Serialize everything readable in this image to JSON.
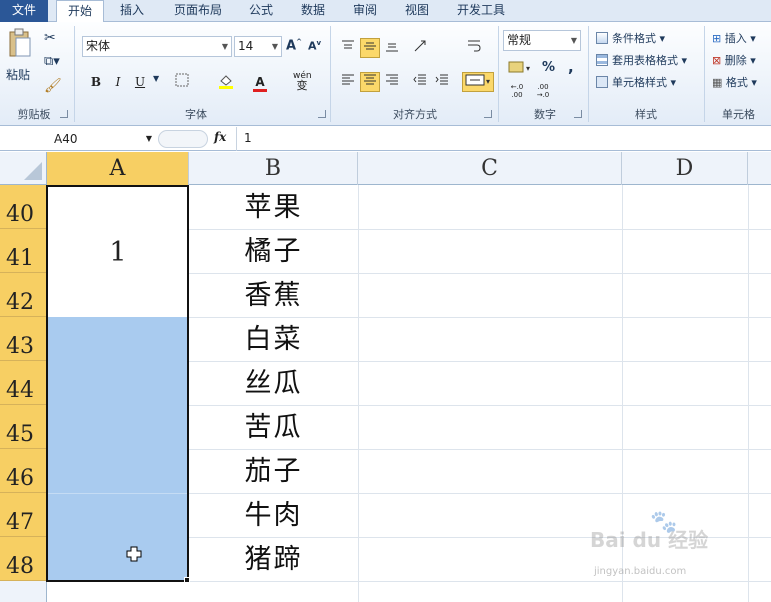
{
  "tabs": [
    "文件",
    "开始",
    "插入",
    "页面布局",
    "公式",
    "数据",
    "审阅",
    "视图",
    "开发工具"
  ],
  "ribbon": {
    "clipboard": {
      "label": "剪贴板",
      "paste": "粘贴"
    },
    "font": {
      "label": "字体",
      "name": "宋体",
      "size": "14",
      "bold": "B",
      "italic": "I",
      "underline": "U",
      "wen": "wén",
      "bian": "变"
    },
    "alignment": {
      "label": "对齐方式"
    },
    "number": {
      "label": "数字",
      "format": "常规",
      "percent": "%",
      "comma": ","
    },
    "styles": {
      "label": "样式",
      "conditional": "条件格式",
      "table": "套用表格格式",
      "cell": "单元格样式"
    },
    "cells": {
      "label": "单元格",
      "insert": "插入",
      "delete": "删除",
      "format": "格式"
    }
  },
  "formula_bar": {
    "name_box": "A40",
    "fx": "fx",
    "value": "1"
  },
  "columns": [
    "A",
    "B",
    "C",
    "D"
  ],
  "rows": [
    {
      "num": "40",
      "b": "苹果"
    },
    {
      "num": "41",
      "b": "橘子"
    },
    {
      "num": "42",
      "b": "香蕉"
    },
    {
      "num": "43",
      "b": "白菜"
    },
    {
      "num": "44",
      "b": "丝瓜"
    },
    {
      "num": "45",
      "b": "苦瓜"
    },
    {
      "num": "46",
      "b": "茄子"
    },
    {
      "num": "47",
      "b": "牛肉"
    },
    {
      "num": "48",
      "b": "猪蹄"
    }
  ],
  "merged_cell_value": "1",
  "watermark": {
    "brand": "Bai du 经验",
    "url": "jingyan.baidu.com"
  },
  "colors": {
    "selection": "#a9cbef",
    "header_selected": "#f7cf63",
    "file_tab": "#2b5797"
  }
}
